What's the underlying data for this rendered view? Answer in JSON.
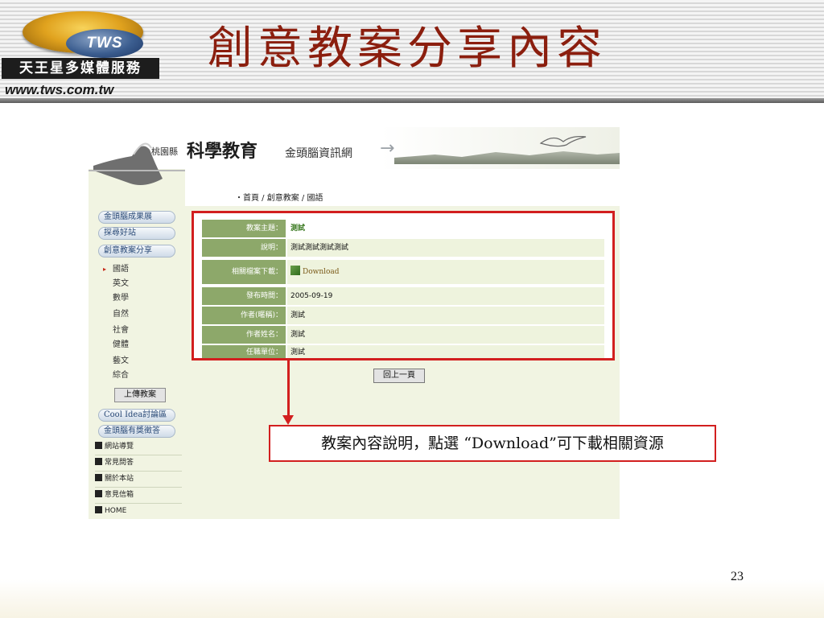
{
  "slide": {
    "title": "創意教案分享內容",
    "page_number": "23",
    "callout": "教案內容說明，點選 “Download”可下載相關資源"
  },
  "logo": {
    "badge": "TWS",
    "company": "天王星多媒體服務",
    "url": "www.tws.com.tw"
  },
  "site": {
    "county": "桃園縣",
    "brand": "科學教育",
    "subtitle": "金頭腦資訊網",
    "arrow": "→",
    "breadcrumb": "・首頁 / 創意教案 / 國語"
  },
  "nav": {
    "top_items": [
      {
        "label": "金頭腦成果展"
      },
      {
        "label": "探尋好站"
      },
      {
        "label": "創意教案分享"
      }
    ],
    "bullet": "▸",
    "sub_items": [
      {
        "label": "國語"
      },
      {
        "label": "英文"
      },
      {
        "label": "數學"
      },
      {
        "label": "自然"
      },
      {
        "label": "社會"
      },
      {
        "label": "健體"
      },
      {
        "label": "藝文"
      },
      {
        "label": "綜合"
      }
    ],
    "upload_button": "上傳教案",
    "bottom_items": [
      {
        "label": "Cool Idea討論區"
      },
      {
        "label": "金頭腦有獎徵答"
      }
    ],
    "utility_links": [
      {
        "label": "網站導覽"
      },
      {
        "label": "常見問答"
      },
      {
        "label": "關於本站"
      },
      {
        "label": "意見信箱"
      },
      {
        "label": "HOME"
      }
    ]
  },
  "detail": {
    "rows": [
      {
        "label": "教案主題：",
        "value": "測試"
      },
      {
        "label": "說明：",
        "value": "測試測試測試測試"
      },
      {
        "label": "相關檔案下載：",
        "value": "Download"
      },
      {
        "label": "發布時間：",
        "value": "2005-09-19"
      },
      {
        "label": "作者(暱稱)：",
        "value": "測試"
      },
      {
        "label": "作者姓名：",
        "value": "測試"
      },
      {
        "label": "任職單位：",
        "value": "測試"
      }
    ],
    "back_button": "回上一頁"
  },
  "colors": {
    "title": "#8b1e0e",
    "highlight": "#d21f1f",
    "label_bg": "#8da86a",
    "value_bg": "#eef3dd"
  }
}
